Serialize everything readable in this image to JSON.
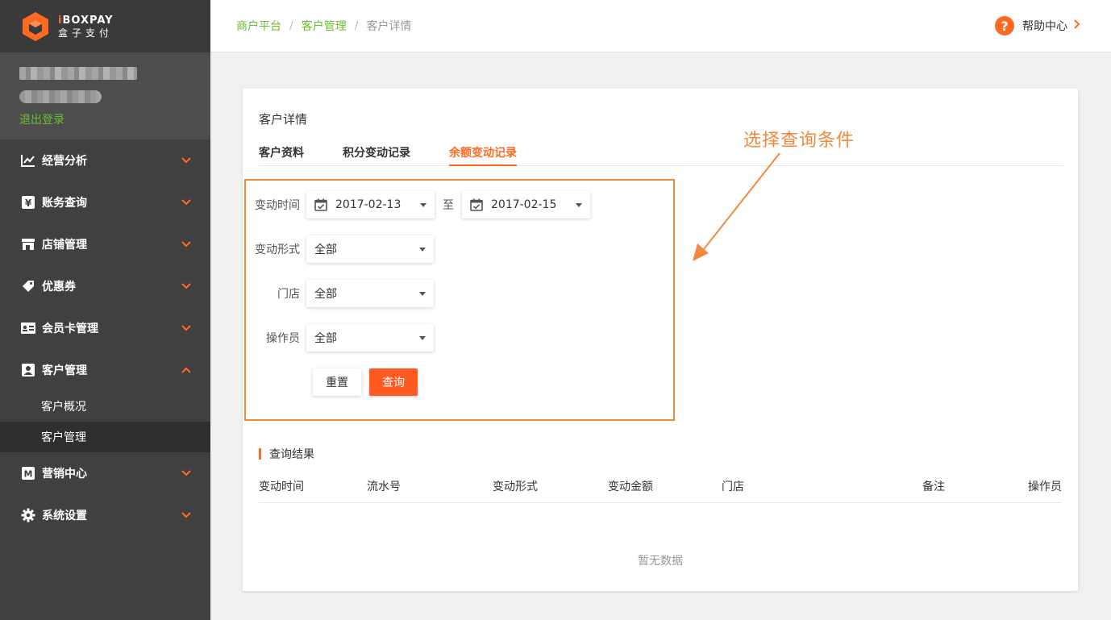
{
  "brand": {
    "name_en_prefix": "i",
    "name_en": "BOXPAY",
    "name_cn": "盒子支付",
    "registered": "®"
  },
  "user": {
    "logout_label": "退出登录"
  },
  "menu": {
    "items": [
      {
        "label": "经营分析",
        "icon": "chart-line-icon",
        "expanded": false
      },
      {
        "label": "账务查询",
        "icon": "yen-icon",
        "expanded": false
      },
      {
        "label": "店铺管理",
        "icon": "store-icon",
        "expanded": false
      },
      {
        "label": "优惠券",
        "icon": "coupon-icon",
        "expanded": false
      },
      {
        "label": "会员卡管理",
        "icon": "card-icon",
        "expanded": false
      },
      {
        "label": "客户管理",
        "icon": "customer-icon",
        "expanded": true
      },
      {
        "label": "营销中心",
        "icon": "marketing-icon",
        "expanded": false
      },
      {
        "label": "系统设置",
        "icon": "gear-icon",
        "expanded": false
      }
    ],
    "submenu": [
      {
        "label": "客户概况",
        "active": false
      },
      {
        "label": "客户管理",
        "active": true
      }
    ]
  },
  "breadcrumb": {
    "items": [
      "商户平台",
      "客户管理"
    ],
    "current": "客户详情",
    "separator": "/"
  },
  "help": {
    "icon_text": "?",
    "label": "帮助中心",
    "arrow": "›"
  },
  "page": {
    "title": "客户详情",
    "tabs": [
      {
        "label": "客户资料",
        "active": false
      },
      {
        "label": "积分变动记录",
        "active": false
      },
      {
        "label": "余额变动记录",
        "active": true
      }
    ]
  },
  "filters": {
    "time_label": "变动时间",
    "date_start": "2017-02-13",
    "to_label": "至",
    "date_end": "2017-02-15",
    "type_label": "变动形式",
    "type_value": "全部",
    "store_label": "门店",
    "store_value": "全部",
    "operator_label": "操作员",
    "operator_value": "全部",
    "reset_label": "重置",
    "query_label": "查询"
  },
  "results": {
    "title": "查询结果",
    "columns": [
      "变动时间",
      "流水号",
      "变动形式",
      "变动金额",
      "门店",
      "备注",
      "操作员"
    ],
    "empty_text": "暂无数据"
  },
  "annotation": {
    "text": "选择查询条件"
  },
  "colors": {
    "accent": "#ff6a22",
    "link_green": "#6cbc2f",
    "sidebar_bg": "#404040",
    "annotation": "#f28a3e"
  }
}
